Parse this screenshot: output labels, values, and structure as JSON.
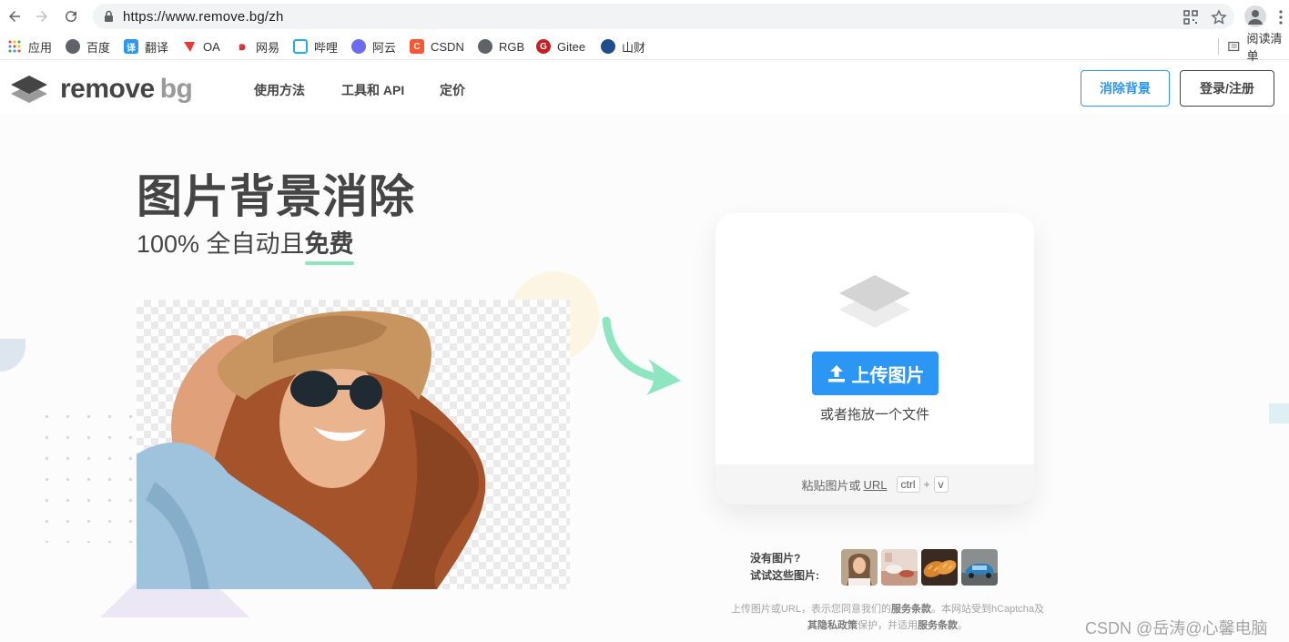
{
  "browser": {
    "url": "https://www.remove.bg/zh",
    "bookmarks": [
      {
        "label": "应用",
        "icon": "apps-grid-icon"
      },
      {
        "label": "百度",
        "icon": "globe-icon"
      },
      {
        "label": "翻译",
        "icon": "translate-icon"
      },
      {
        "label": "OA",
        "icon": "oa-icon"
      },
      {
        "label": "网易",
        "icon": "netease-icon"
      },
      {
        "label": "哔哩",
        "icon": "bilibili-icon"
      },
      {
        "label": "阿云",
        "icon": "aliyun-icon"
      },
      {
        "label": "CSDN",
        "icon": "csdn-icon"
      },
      {
        "label": "RGB",
        "icon": "globe-icon"
      },
      {
        "label": "Gitee",
        "icon": "gitee-icon"
      },
      {
        "label": "山财",
        "icon": "university-icon"
      }
    ],
    "reading_list": "阅读清单"
  },
  "site": {
    "logo_main": "remove",
    "logo_bg": "bg",
    "nav": [
      "使用方法",
      "工具和 API",
      "定价"
    ],
    "remove_bg_button": "消除背景",
    "login_button": "登录/注册"
  },
  "hero": {
    "title": "图片背景消除",
    "subtitle_prefix": "100% 全自动且",
    "subtitle_free": "免费"
  },
  "upload": {
    "button_label": "上传图片",
    "drop_text": "或者拖放一个文件",
    "paste_prefix": "粘贴图片或",
    "paste_url": "URL",
    "key_ctrl": "ctrl",
    "key_plus": "+",
    "key_v": "v"
  },
  "samples": {
    "label_line1": "没有图片?",
    "label_line2": "试试这些图片:",
    "items": [
      "woman-portrait",
      "kitchen-food",
      "bread-loaves",
      "blue-car"
    ]
  },
  "terms": {
    "line1_prefix": "上传图片或URL，表示您同意我们的",
    "line1_bold": "服务条款",
    "line1_suffix": "。本网站受到hCaptcha及",
    "line2_bold1": "其隐私政策",
    "line2_mid": "保护，并适用",
    "line2_bold2": "服务条款",
    "line2_suffix": "。"
  },
  "watermark": "CSDN @岳涛@心馨电脑",
  "colors": {
    "accent_blue": "#2c96f5",
    "text_dark": "#454545",
    "mint_underline": "#8ee6c1",
    "arrow_green": "#8ee6c1"
  }
}
